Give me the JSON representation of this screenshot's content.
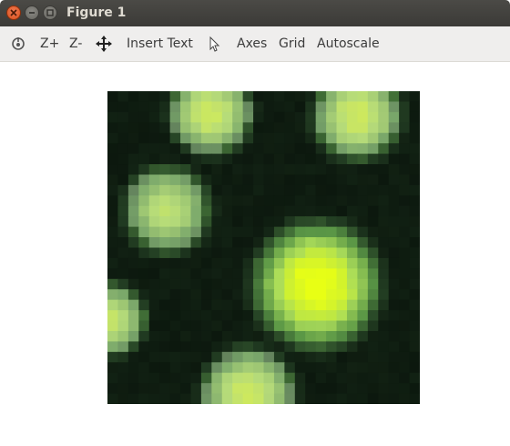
{
  "window": {
    "title": "Figure 1",
    "buttons": [
      "close",
      "minimize",
      "maximize"
    ]
  },
  "toolbar": {
    "home_icon": "home-icon",
    "zoom_in_label": "Z+",
    "zoom_out_label": "Z-",
    "pan_icon": "pan-icon",
    "insert_text_label": "Insert Text",
    "pointer_icon": "pointer-icon",
    "axes_label": "Axes",
    "grid_label": "Grid",
    "autoscale_label": "Autoscale"
  },
  "colors": {
    "titlebar": "#3c3b37",
    "toolbar": "#efeeed",
    "close_button": "#e95420",
    "canvas": "#ffffff",
    "palette_dark": "#0b1a0d",
    "palette_mid": "#4f8f3a",
    "palette_bright": "#e8ff10"
  }
}
